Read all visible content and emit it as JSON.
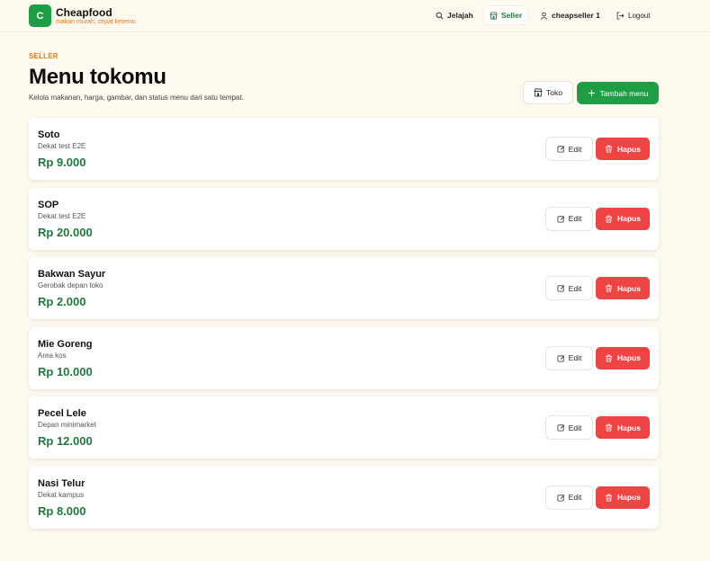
{
  "brand": {
    "logo_letter": "C",
    "name": "Cheapfood",
    "tagline": "makan murah, cepat ketemu"
  },
  "nav": {
    "explore": "Jelajah",
    "seller": "Seller",
    "user": "cheapseller 1",
    "logout": "Logout"
  },
  "page": {
    "eyebrow": "SELLER",
    "title": "Menu tokomu",
    "description": "Kelola makanan, harga, gambar, dan status menu dari satu tempat."
  },
  "actions": {
    "store": "Toko",
    "add_menu": "Tambah menu"
  },
  "menu_items": [
    {
      "name": "Soto",
      "location": "Dekat test E2E",
      "price": "Rp 9.000",
      "edit": "Edit",
      "delete": "Hapus"
    },
    {
      "name": "SOP",
      "location": "Dekat test E2E",
      "price": "Rp 20.000",
      "edit": "Edit",
      "delete": "Hapus"
    },
    {
      "name": "Bakwan Sayur",
      "location": "Gerobak depan toko",
      "price": "Rp 2.000",
      "edit": "Edit",
      "delete": "Hapus"
    },
    {
      "name": "Mie Goreng",
      "location": "Area kos",
      "price": "Rp 10.000",
      "edit": "Edit",
      "delete": "Hapus"
    },
    {
      "name": "Pecel Lele",
      "location": "Depan minimarket",
      "price": "Rp 12.000",
      "edit": "Edit",
      "delete": "Hapus"
    },
    {
      "name": "Nasi Telur",
      "location": "Dekat kampus",
      "price": "Rp 8.000",
      "edit": "Edit",
      "delete": "Hapus"
    }
  ],
  "colors": {
    "brand_green": "#1f9d45",
    "accent_orange": "#e07b17",
    "danger_red": "#ef4444",
    "price_green": "#1e7a3a",
    "background": "#fdf9ef"
  },
  "icons": {
    "explore": "search-icon",
    "seller": "store-icon",
    "user": "user-icon",
    "logout": "logout-icon",
    "store": "store-icon",
    "add": "plus-icon",
    "edit": "edit-icon",
    "delete": "trash-icon"
  }
}
